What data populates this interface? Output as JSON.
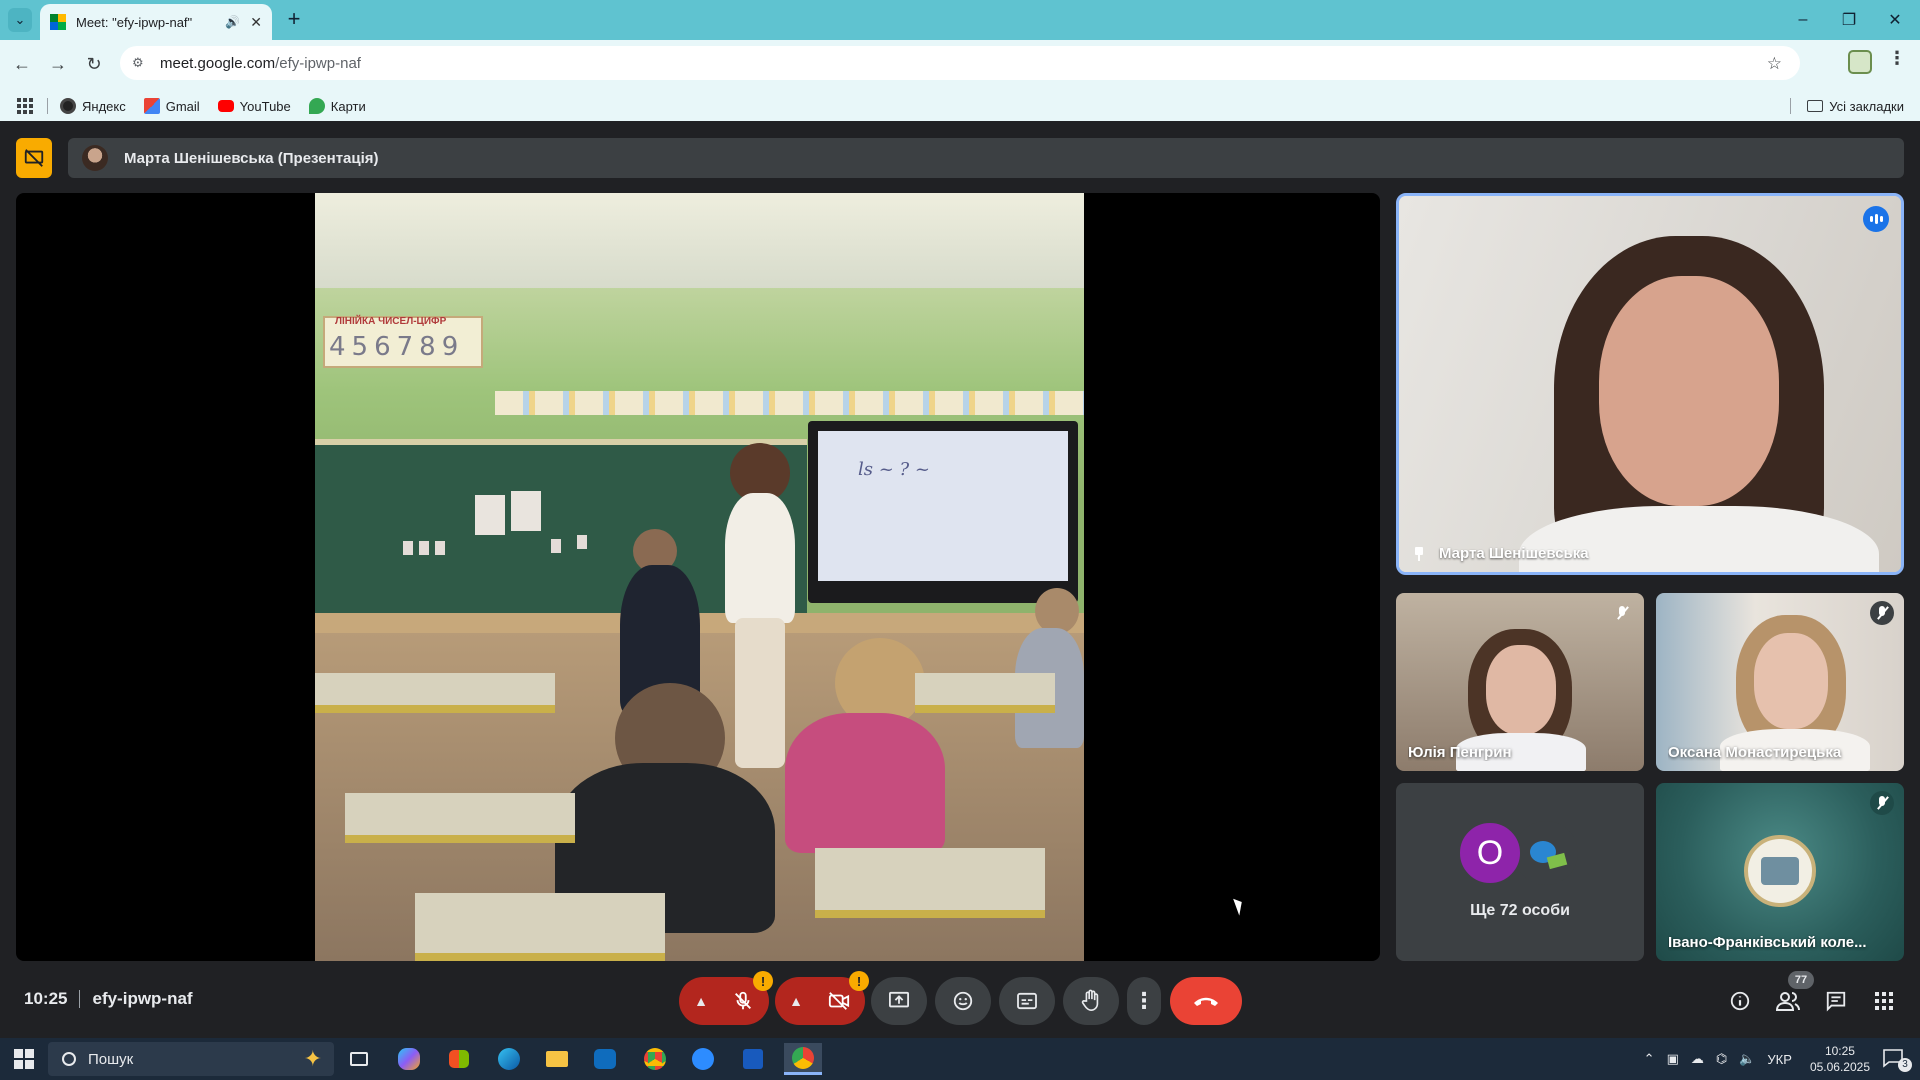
{
  "browser": {
    "tab_title": "Meet: \"efy-ipwp-naf\"",
    "url_host": "meet.google.com",
    "url_path": "/efy-ipwp-naf",
    "bookmarks": [
      "Яндекс",
      "Gmail",
      "YouTube",
      "Карти"
    ],
    "all_bookmarks_label": "Усі закладки"
  },
  "meet": {
    "presenter_label": "Марта Шенішевська (Презентація)",
    "slide_numline_title": "ЛІНІЙКА ЧИСЕЛ-ЦИФР",
    "slide_numline_digits": "456789",
    "main_tile_name": "Марта Шенішевська",
    "participants": [
      {
        "name": "Юлія Пенгрин"
      },
      {
        "name": "Оксана Монастирецька"
      }
    ],
    "more_avatar_letter": "О",
    "more_label": "Ще 72 особи",
    "college_tile_name": "Івано-Франківський коле...",
    "time": "10:25",
    "meeting_code": "efy-ipwp-naf",
    "people_count": "77",
    "warn_symbol": "!"
  },
  "taskbar": {
    "search_placeholder": "Пошук",
    "language": "УКР",
    "time": "10:25",
    "date": "05.06.2025",
    "notification_count": "3"
  },
  "colors": {
    "accent_blue": "#8ab4f8",
    "end_call": "#ea4335",
    "present_chip": "#f9ab00",
    "tab_bar": "#5fc3d0"
  }
}
